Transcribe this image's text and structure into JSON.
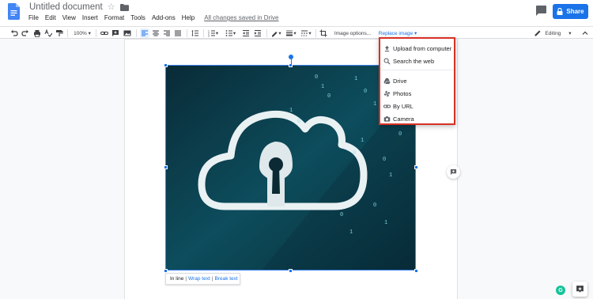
{
  "header": {
    "title": "Untitled document",
    "menu": [
      "File",
      "Edit",
      "View",
      "Insert",
      "Format",
      "Tools",
      "Add-ons",
      "Help"
    ],
    "save_status": "All changes saved in Drive",
    "share_label": "Share"
  },
  "toolbar": {
    "zoom": "100%",
    "image_options": "Image options...",
    "replace_image": "Replace image",
    "mode": "Editing"
  },
  "replace_menu": {
    "items": [
      {
        "label": "Upload from computer",
        "icon": "upload-icon"
      },
      {
        "label": "Search the web",
        "icon": "search-icon"
      },
      {
        "label": "Drive",
        "icon": "drive-icon"
      },
      {
        "label": "Photos",
        "icon": "photos-icon"
      },
      {
        "label": "By URL",
        "icon": "link-icon"
      },
      {
        "label": "Camera",
        "icon": "camera-icon"
      }
    ]
  },
  "wrap_options": {
    "inline": "In line",
    "wrap": "Wrap text",
    "break": "Break text",
    "separator": "|"
  },
  "image": {
    "subject": "cloud-lock-on-binary-code",
    "digit_zero": "0",
    "digit_one": "1"
  },
  "grammarly_badge": "G",
  "colors": {
    "accent": "#1a73e8",
    "highlight_border": "#d93025",
    "image_teal": "#1fa3b7"
  }
}
